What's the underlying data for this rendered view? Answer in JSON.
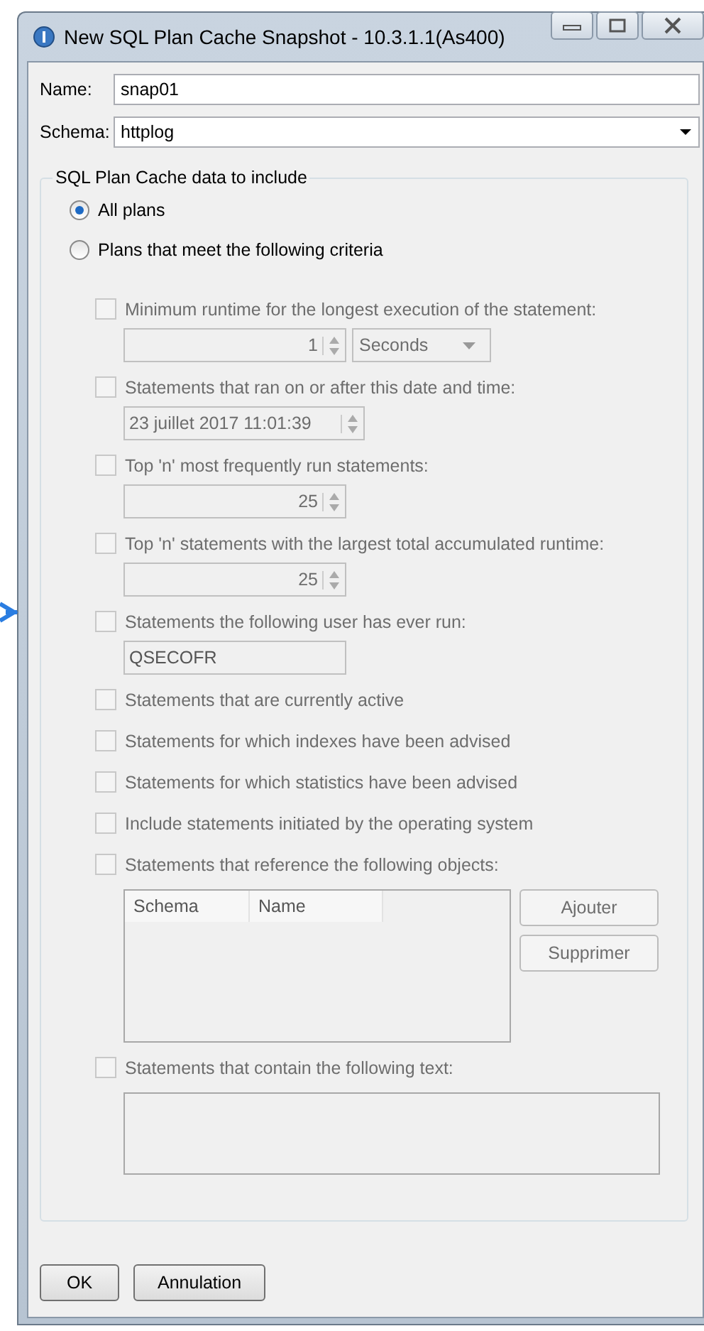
{
  "window": {
    "title": "New SQL Plan Cache Snapshot - 10.3.1.1(As400)"
  },
  "fields": [
    {
      "label": "Name:",
      "value": "snap01",
      "kind": "text"
    },
    {
      "label": "Schema:",
      "value": "httplog",
      "kind": "dropdown"
    }
  ],
  "group": {
    "title": "SQL Plan Cache data to include"
  },
  "scope": [
    {
      "label": "All plans",
      "selected": true
    },
    {
      "label": "Plans that meet the following criteria",
      "selected": false
    }
  ],
  "criteria": [
    {
      "label": "Minimum runtime for the longest execution of the statement:",
      "checked": false,
      "disabled": true,
      "input": {
        "kind": "spin-unit",
        "value": "1",
        "unit": "Seconds"
      }
    },
    {
      "label": "Statements that ran on or after this date and time:",
      "checked": false,
      "disabled": true,
      "input": {
        "kind": "date",
        "value": "23 juillet 2017 11:01:39"
      }
    },
    {
      "label": "Top 'n' most frequently run statements:",
      "checked": false,
      "disabled": true,
      "input": {
        "kind": "spin",
        "value": "25"
      }
    },
    {
      "label": "Top 'n' statements with the largest total accumulated runtime:",
      "checked": false,
      "disabled": true,
      "input": {
        "kind": "spin",
        "value": "25"
      }
    },
    {
      "label": "Statements the following user has ever run:",
      "checked": false,
      "disabled": true,
      "input": {
        "kind": "text",
        "value": "QSECOFR"
      }
    },
    {
      "label": "Statements that are currently active",
      "checked": false,
      "disabled": true
    },
    {
      "label": "Statements for which indexes have been advised",
      "checked": false,
      "disabled": true
    },
    {
      "label": "Statements for which statistics have been advised",
      "checked": false,
      "disabled": true
    },
    {
      "label": "Include statements initiated by the operating system",
      "checked": false,
      "disabled": true
    },
    {
      "label": "Statements that reference the following objects:",
      "checked": false,
      "disabled": true,
      "input": {
        "kind": "table",
        "columns": [
          "Schema",
          "Name"
        ],
        "buttons": [
          "Ajouter",
          "Supprimer"
        ]
      }
    },
    {
      "label": "Statements that contain the following text:",
      "checked": false,
      "disabled": true,
      "input": {
        "kind": "textarea"
      }
    }
  ],
  "buttons": [
    "OK",
    "Annulation"
  ]
}
